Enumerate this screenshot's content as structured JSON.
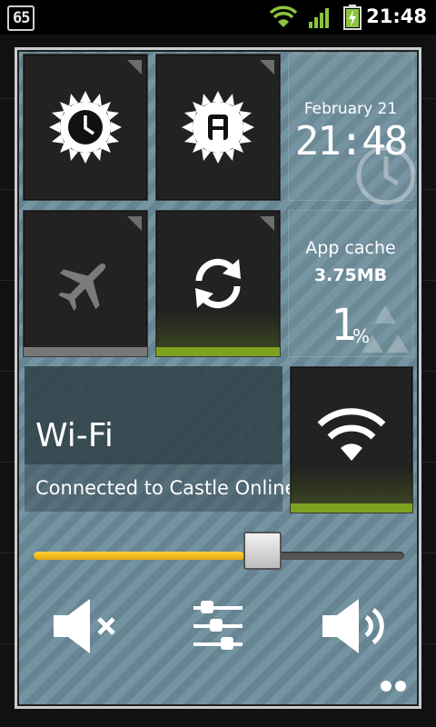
{
  "statusbar": {
    "notification_count": "65",
    "time": "21:48",
    "battery_color": "#8bc53f"
  },
  "tiles": {
    "auto_brightness": {
      "icon": "brightness-clock-icon"
    },
    "auto_brightness_a": {
      "icon": "brightness-auto-icon"
    },
    "clock": {
      "date": "February 21",
      "time": "21:48"
    },
    "airplane": {
      "icon": "airplane-icon",
      "state": "off"
    },
    "sync": {
      "icon": "sync-icon",
      "state": "on"
    },
    "app_cache": {
      "title": "App cache",
      "size": "3.75MB",
      "percent_value": "1",
      "percent_sign": "%"
    },
    "wifi": {
      "title": "Wi-Fi",
      "status": "Connected to Castle Online",
      "state": "on"
    }
  },
  "volume": {
    "level_percent": 57
  },
  "controls": {
    "mute": {
      "icon": "mute-icon"
    },
    "settings": {
      "icon": "sliders-icon"
    },
    "volume": {
      "icon": "speaker-icon"
    }
  },
  "colors": {
    "accent_on": "#7ea21f",
    "slider_fill": "#f2b818"
  }
}
